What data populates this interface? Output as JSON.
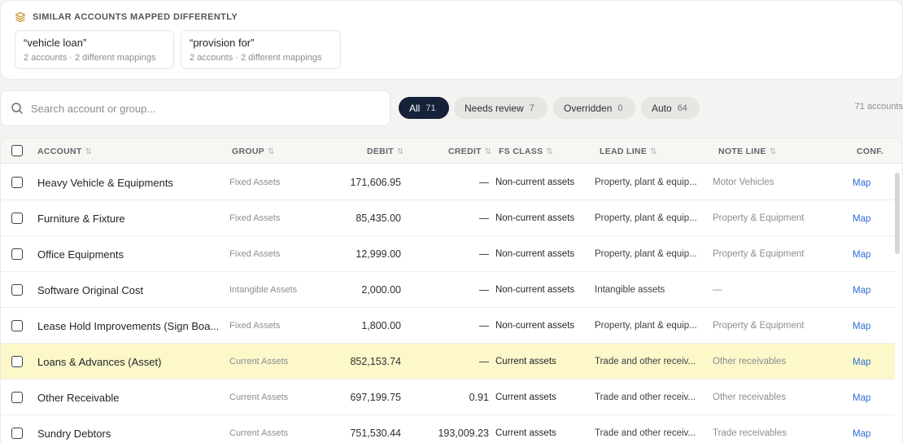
{
  "similar": {
    "title": "SIMILAR ACCOUNTS MAPPED DIFFERENTLY",
    "icon": "layers-icon",
    "groups": [
      {
        "phrase": "“vehicle loan”",
        "detail": "2 accounts · 2 different mappings"
      },
      {
        "phrase": "“provision for”",
        "detail": "2 accounts · 2 different mappings"
      }
    ]
  },
  "search": {
    "placeholder": "Search account or group...",
    "icon": "search-icon"
  },
  "filters": [
    {
      "label": "All",
      "count": "71",
      "active": true
    },
    {
      "label": "Needs review",
      "count": "7",
      "active": false
    },
    {
      "label": "Overridden",
      "count": "0",
      "active": false
    },
    {
      "label": "Auto",
      "count": "64",
      "active": false
    }
  ],
  "total_accounts": "71 accounts",
  "table": {
    "columns": {
      "account": "ACCOUNT",
      "group": "GROUP",
      "debit": "DEBIT",
      "credit": "CREDIT",
      "fs_class": "FS CLASS",
      "lead_line": "LEAD LINE",
      "note_line": "NOTE LINE",
      "conf": "CONF."
    },
    "sort_glyph": "⇅",
    "rows": [
      {
        "account": "Heavy Vehicle & Equipments",
        "group": "Fixed Assets",
        "debit": "171,606.95",
        "credit": "—",
        "fs_class": "Non-current assets",
        "lead_line": "Property, plant & equip...",
        "note_line": "Motor Vehicles",
        "action": "Map",
        "highlight": false
      },
      {
        "account": "Furniture & Fixture",
        "group": "Fixed Assets",
        "debit": "85,435.00",
        "credit": "—",
        "fs_class": "Non-current assets",
        "lead_line": "Property, plant & equip...",
        "note_line": "Property & Equipment",
        "action": "Map",
        "highlight": false
      },
      {
        "account": "Office Equipments",
        "group": "Fixed Assets",
        "debit": "12,999.00",
        "credit": "—",
        "fs_class": "Non-current assets",
        "lead_line": "Property, plant & equip...",
        "note_line": "Property & Equipment",
        "action": "Map",
        "highlight": false
      },
      {
        "account": "Software Original Cost",
        "group": "Intangible Assets",
        "debit": "2,000.00",
        "credit": "—",
        "fs_class": "Non-current assets",
        "lead_line": "Intangible assets",
        "note_line": "—",
        "action": "Map",
        "highlight": false
      },
      {
        "account": "Lease Hold Improvements (Sign Boa...",
        "group": "Fixed Assets",
        "debit": "1,800.00",
        "credit": "—",
        "fs_class": "Non-current assets",
        "lead_line": "Property, plant & equip...",
        "note_line": "Property & Equipment",
        "action": "Map",
        "highlight": false
      },
      {
        "account": "Loans & Advances (Asset)",
        "group": "Current Assets",
        "debit": "852,153.74",
        "credit": "—",
        "fs_class": "Current assets",
        "lead_line": "Trade and other receiv...",
        "note_line": "Other receivables",
        "action": "Map",
        "highlight": true
      },
      {
        "account": "Other Receivable",
        "group": "Current Assets",
        "debit": "697,199.75",
        "credit": "0.91",
        "fs_class": "Current assets",
        "lead_line": "Trade and other receiv...",
        "note_line": "Other receivables",
        "action": "Map",
        "highlight": false
      },
      {
        "account": "Sundry Debtors",
        "group": "Current Assets",
        "debit": "751,530.44",
        "credit": "193,009.23",
        "fs_class": "Current assets",
        "lead_line": "Trade and other receiv...",
        "note_line": "Trade receivables",
        "action": "Map",
        "highlight": false
      }
    ]
  },
  "colors": {
    "accent": "#16213a",
    "highlight_row": "#fcf8c9",
    "link": "#2e6fd4",
    "icon_accent": "#c8912a"
  }
}
